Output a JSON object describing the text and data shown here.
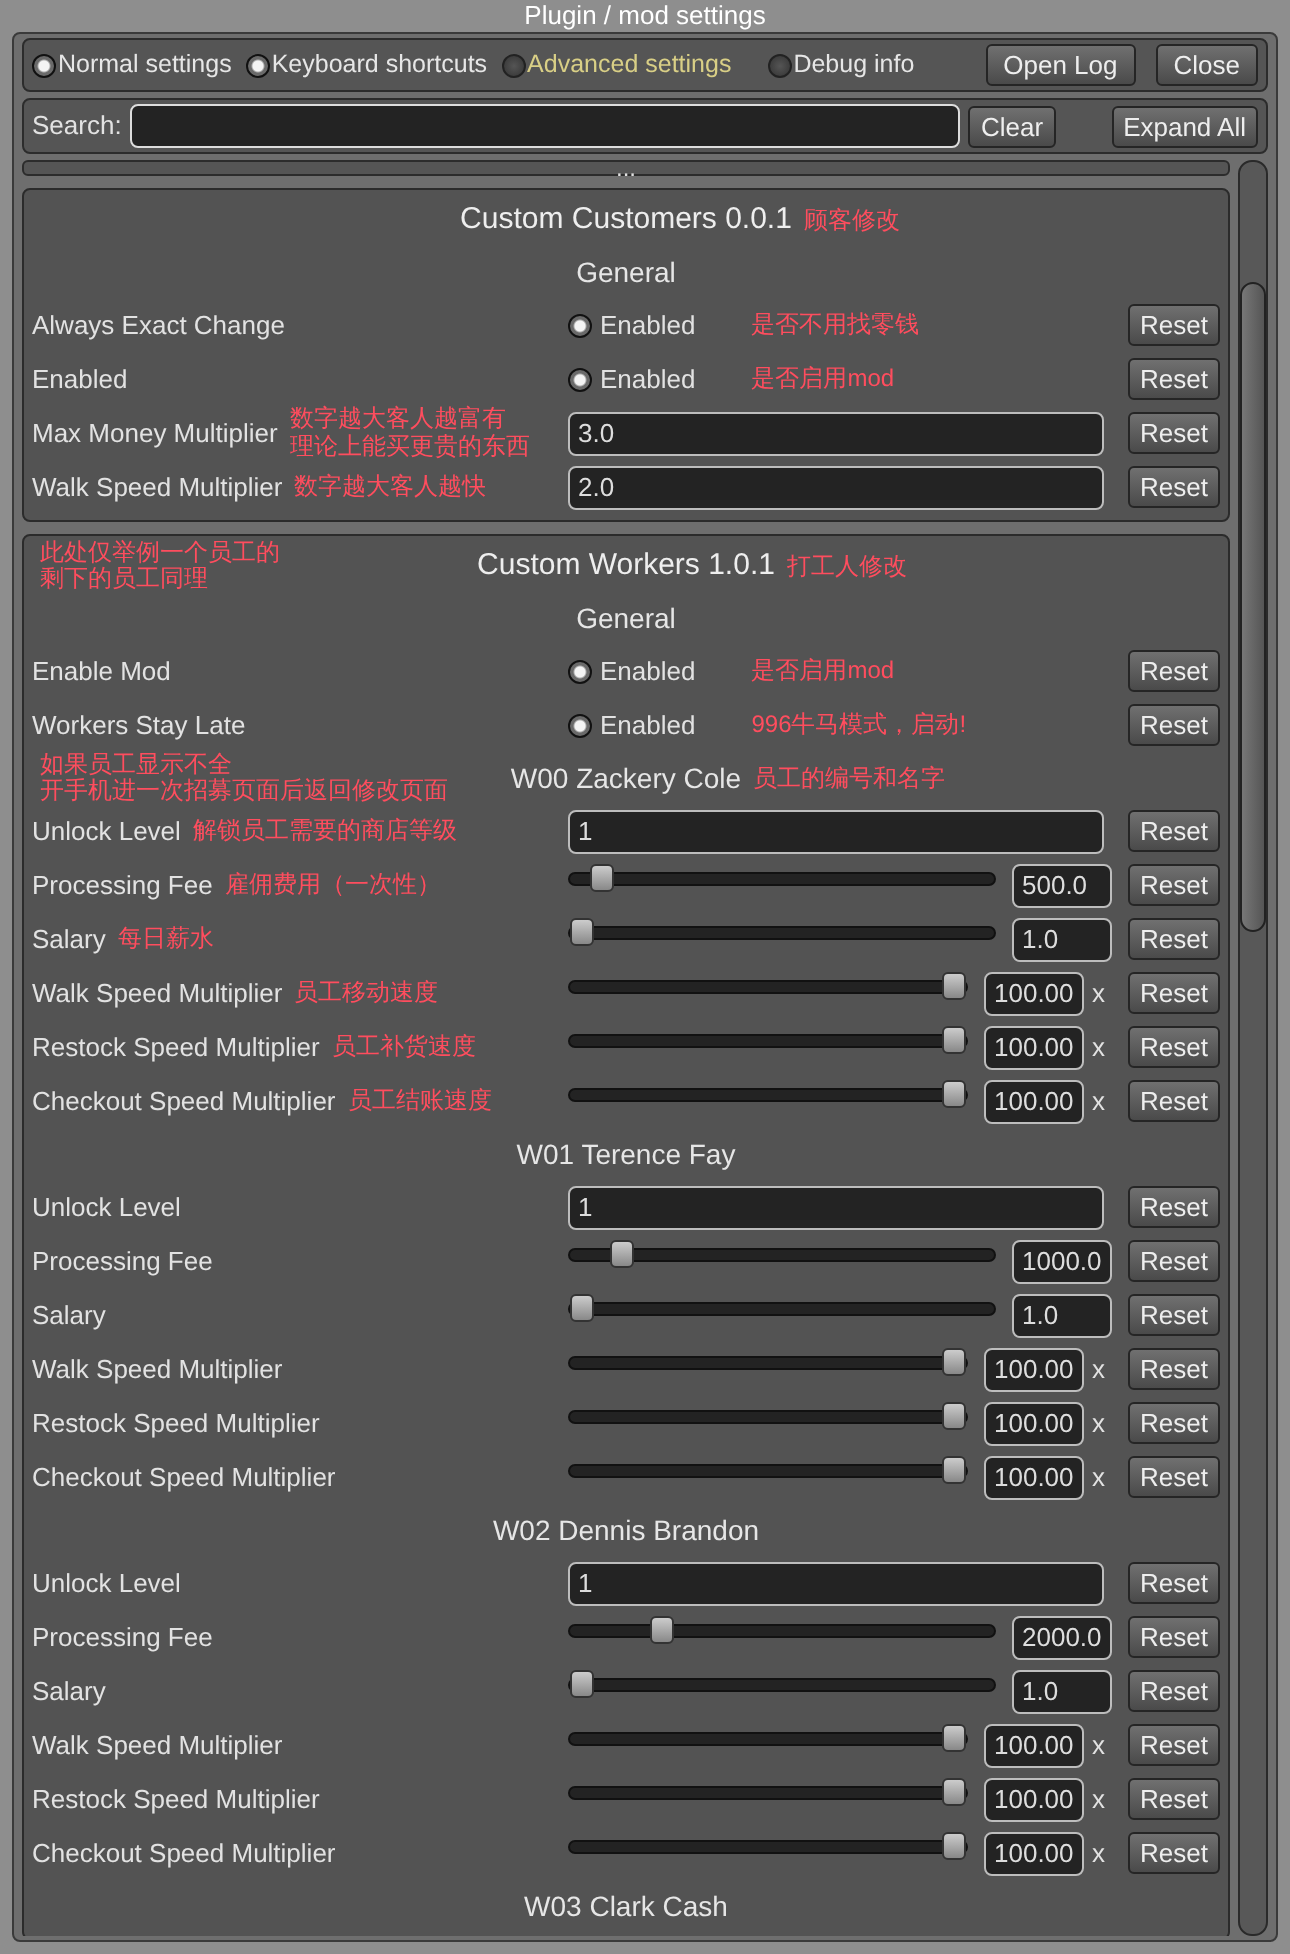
{
  "window": {
    "title": "Plugin / mod settings"
  },
  "toolbar": {
    "toggles": [
      {
        "label": "Normal settings",
        "checked": true,
        "color": "#e6e6e6"
      },
      {
        "label": "Keyboard shortcuts",
        "checked": true,
        "color": "#e6e6e6"
      },
      {
        "label": "Advanced settings",
        "checked": false,
        "color": "#d9cf86"
      },
      {
        "label": "Debug info",
        "checked": false,
        "color": "#e6e6e6"
      }
    ],
    "buttons": [
      "Open Log",
      "Close"
    ]
  },
  "search": {
    "label": "Search:",
    "buttons": [
      "Clear",
      "Expand All"
    ]
  },
  "collapsed_section": {
    "label": "..."
  },
  "sections": [
    {
      "title": "Custom Customers 0.0.1",
      "title_note": "顾客修改",
      "groups": [
        {
          "title": "General",
          "rows": [
            {
              "kind": "toggle",
              "label": "Always Exact Change",
              "on": true,
              "option": "Enabled",
              "note": "是否不用找零钱",
              "reset": "Reset"
            },
            {
              "kind": "toggle",
              "label": "Enabled",
              "on": true,
              "option": "Enabled",
              "note": "是否启用mod",
              "reset": "Reset"
            },
            {
              "kind": "text",
              "label": "Max Money Multiplier",
              "note": [
                "数字越大客人越富有",
                "理论上能买更贵的东西"
              ],
              "value": "3.0",
              "reset": "Reset"
            },
            {
              "kind": "text",
              "label": "Walk Speed Multiplier",
              "note": "数字越大客人越快",
              "value": "2.0",
              "reset": "Reset"
            }
          ]
        }
      ]
    },
    {
      "title": "Custom Workers 1.0.1",
      "title_note": "打工人修改",
      "left_note": [
        "此处仅举例一个员工的",
        "剩下的员工同理"
      ],
      "groups": [
        {
          "title": "General",
          "rows": [
            {
              "kind": "toggle",
              "label": "Enable Mod",
              "on": true,
              "option": "Enabled",
              "note": "是否启用mod",
              "reset": "Reset"
            },
            {
              "kind": "toggle",
              "label": "Workers Stay Late",
              "on": true,
              "option": "Enabled",
              "note": "996牛马模式，启动!",
              "reset": "Reset"
            }
          ]
        },
        {
          "title": "W00 Zackery Cole",
          "title_note": "员工的编号和名字",
          "left_note": [
            "如果员工显示不全",
            "开手机进一次招募页面后返回修改页面"
          ],
          "rows": [
            {
              "kind": "text",
              "label": "Unlock Level",
              "note": "解锁员工需要的商店等级",
              "value": "1",
              "reset": "Reset"
            },
            {
              "kind": "slider",
              "label": "Processing Fee",
              "note": "雇佣费用（一次性）",
              "level": 0.05,
              "value": "500.0",
              "reset": "Reset"
            },
            {
              "kind": "slider",
              "label": "Salary",
              "note": "每日薪水",
              "level": 0,
              "value": "1.0",
              "reset": "Reset"
            },
            {
              "kind": "slider",
              "label": "Walk Speed Multiplier",
              "note": "员工移动速度",
              "level": 1,
              "value": "100.00",
              "suffix": "x",
              "reset": "Reset"
            },
            {
              "kind": "slider",
              "label": "Restock Speed Multiplier",
              "note": "员工补货速度",
              "level": 1,
              "value": "100.00",
              "suffix": "x",
              "reset": "Reset"
            },
            {
              "kind": "slider",
              "label": "Checkout Speed Multiplier",
              "note": "员工结账速度",
              "level": 1,
              "value": "100.00",
              "suffix": "x",
              "reset": "Reset"
            }
          ]
        },
        {
          "title": "W01 Terence Fay",
          "rows": [
            {
              "kind": "text",
              "label": "Unlock Level",
              "value": "1",
              "reset": "Reset"
            },
            {
              "kind": "slider",
              "label": "Processing Fee",
              "level": 0.1,
              "value": "1000.0",
              "reset": "Reset"
            },
            {
              "kind": "slider",
              "label": "Salary",
              "level": 0,
              "value": "1.0",
              "reset": "Reset"
            },
            {
              "kind": "slider",
              "label": "Walk Speed Multiplier",
              "level": 1,
              "value": "100.00",
              "suffix": "x",
              "reset": "Reset"
            },
            {
              "kind": "slider",
              "label": "Restock Speed Multiplier",
              "level": 1,
              "value": "100.00",
              "suffix": "x",
              "reset": "Reset"
            },
            {
              "kind": "slider",
              "label": "Checkout Speed Multiplier",
              "level": 1,
              "value": "100.00",
              "suffix": "x",
              "reset": "Reset"
            }
          ]
        },
        {
          "title": "W02 Dennis Brandon",
          "rows": [
            {
              "kind": "text",
              "label": "Unlock Level",
              "value": "1",
              "reset": "Reset"
            },
            {
              "kind": "slider",
              "label": "Processing Fee",
              "level": 0.2,
              "value": "2000.0",
              "reset": "Reset"
            },
            {
              "kind": "slider",
              "label": "Salary",
              "level": 0,
              "value": "1.0",
              "reset": "Reset"
            },
            {
              "kind": "slider",
              "label": "Walk Speed Multiplier",
              "level": 1,
              "value": "100.00",
              "suffix": "x",
              "reset": "Reset"
            },
            {
              "kind": "slider",
              "label": "Restock Speed Multiplier",
              "level": 1,
              "value": "100.00",
              "suffix": "x",
              "reset": "Reset"
            },
            {
              "kind": "slider",
              "label": "Checkout Speed Multiplier",
              "level": 1,
              "value": "100.00",
              "suffix": "x",
              "reset": "Reset"
            }
          ]
        },
        {
          "title": "W03 Clark Cash"
        }
      ]
    }
  ]
}
